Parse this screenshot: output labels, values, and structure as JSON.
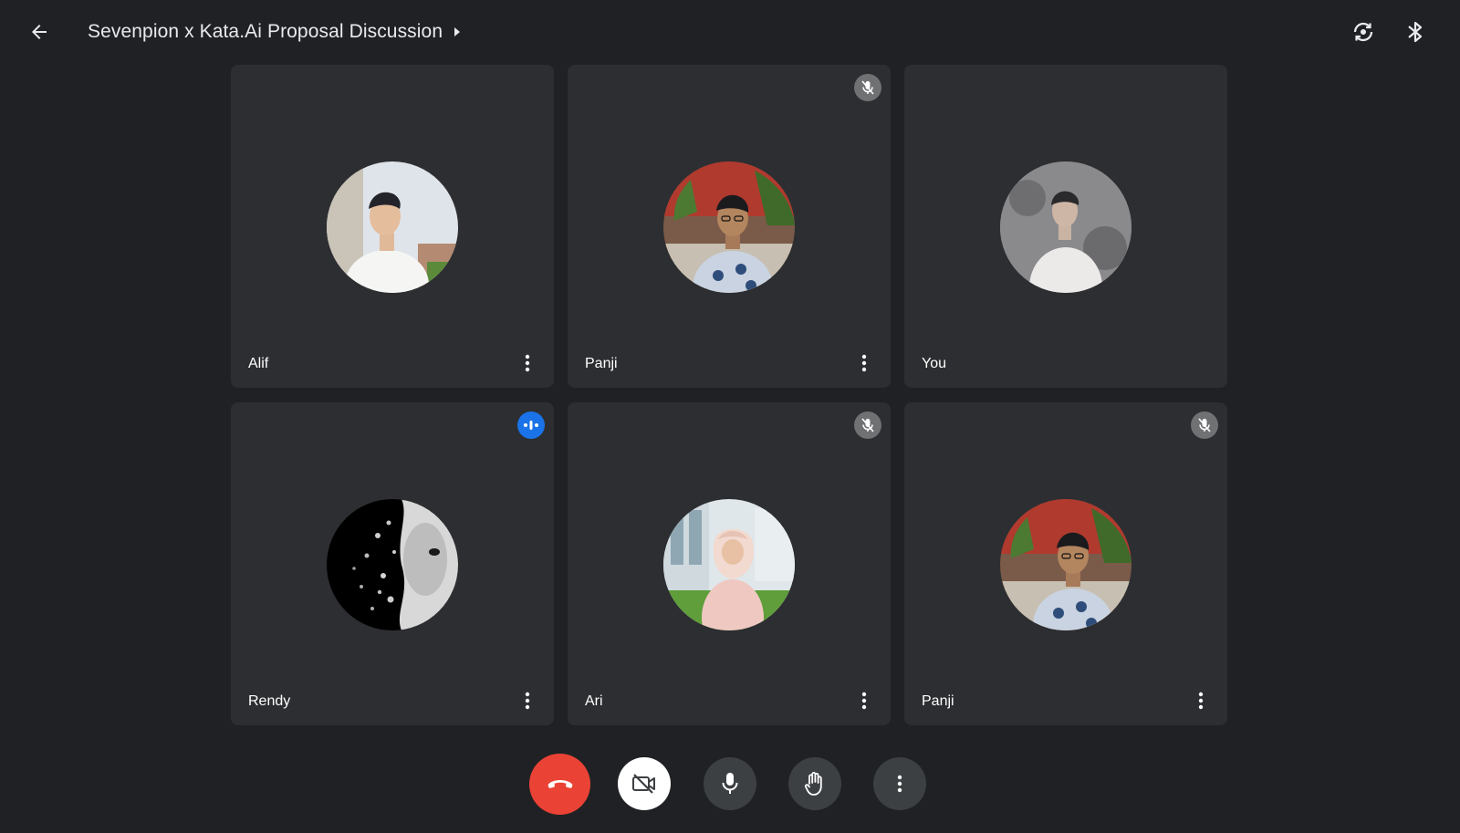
{
  "header": {
    "meeting_title": "Sevenpion x Kata.Ai Proposal Discussion",
    "back_icon": "arrow-back-icon",
    "caret_icon": "caret-right-icon",
    "switch_camera_icon": "switch-camera-icon",
    "bluetooth_icon": "bluetooth-icon"
  },
  "participants": [
    {
      "name": "Alif",
      "status": "none",
      "avatar": "photo"
    },
    {
      "name": "Panji",
      "status": "muted",
      "avatar": "photo"
    },
    {
      "name": "You",
      "status": "none",
      "avatar": "photo"
    },
    {
      "name": "Rendy",
      "status": "speaking",
      "avatar": "photo"
    },
    {
      "name": "Ari",
      "status": "muted",
      "avatar": "photo"
    },
    {
      "name": "Panji",
      "status": "muted",
      "avatar": "photo"
    }
  ],
  "controls": {
    "hangup_icon": "call-end-icon",
    "camera_icon": "camera-off-icon",
    "mic_icon": "mic-icon",
    "raise_hand_icon": "hand-icon",
    "more_icon": "more-vert-icon"
  },
  "colors": {
    "background": "#202124",
    "tile": "#2d2e31",
    "hangup": "#ea4335",
    "speaking": "#1a73e8"
  }
}
